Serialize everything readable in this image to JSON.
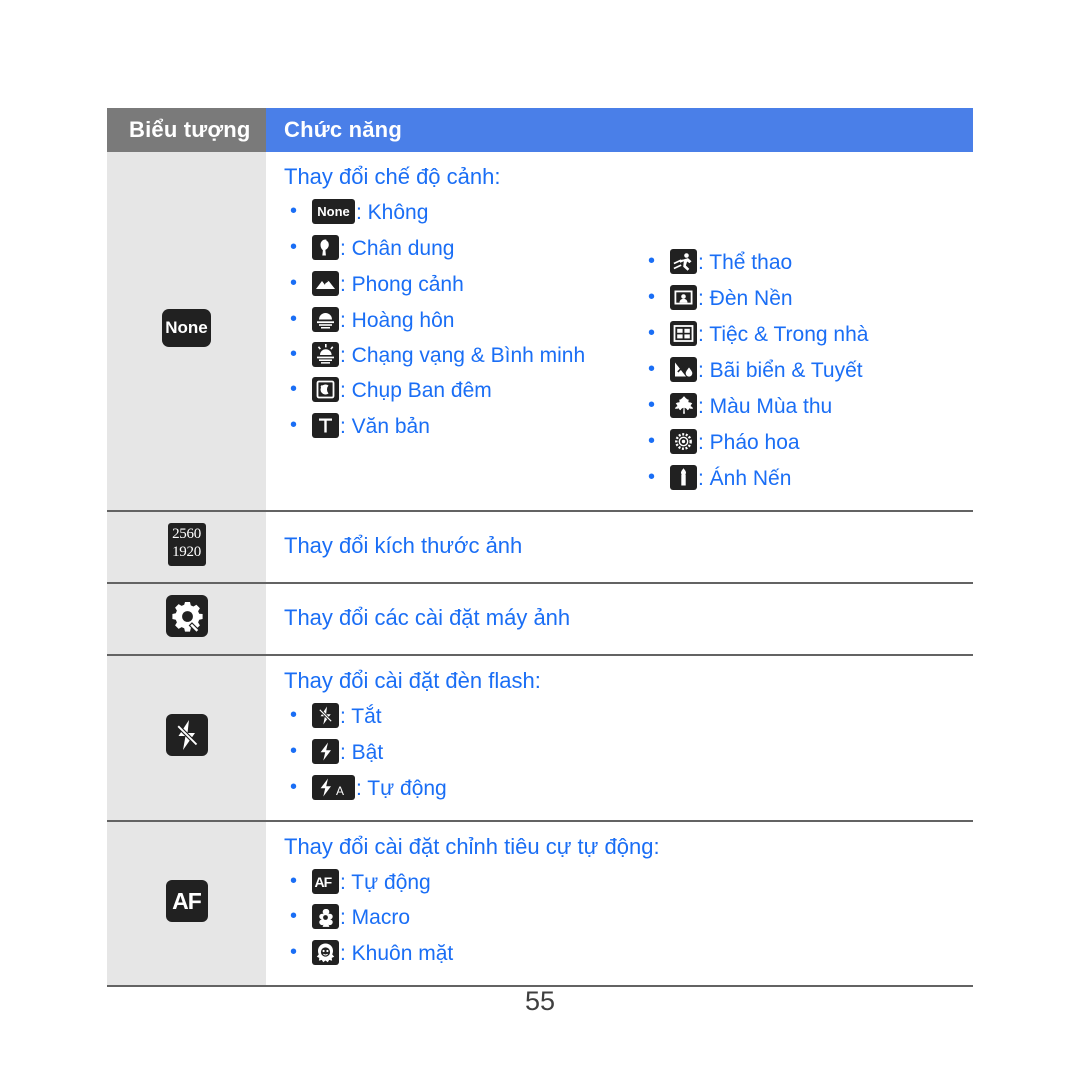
{
  "table": {
    "headers": {
      "icon_column": "Biểu tượng",
      "function_column": "Chức năng"
    },
    "rows": [
      {
        "id": "scene-mode",
        "icon_label": "None",
        "icon_name": "scene-none-icon",
        "title": "Thay đổi chế độ cảnh:",
        "options_left": [
          {
            "icon": "none-chip",
            "label": ": Không"
          },
          {
            "icon": "portrait",
            "label": ": Chân dung"
          },
          {
            "icon": "landscape",
            "label": ": Phong cảnh"
          },
          {
            "icon": "sunset",
            "label": ": Hoàng hôn"
          },
          {
            "icon": "dawn",
            "label": ": Chạng vạng & Bình minh"
          },
          {
            "icon": "night",
            "label": ": Chụp Ban đêm"
          },
          {
            "icon": "text",
            "label": ": Văn bản"
          }
        ],
        "options_right": [
          {
            "icon": "sports",
            "label": ": Thể thao"
          },
          {
            "icon": "backlight",
            "label": ": Đèn Nền"
          },
          {
            "icon": "party",
            "label": ": Tiệc & Trong nhà"
          },
          {
            "icon": "beach",
            "label": ": Bãi biển & Tuyết"
          },
          {
            "icon": "autumn",
            "label": ": Màu Mùa thu"
          },
          {
            "icon": "firework",
            "label": ": Pháo hoa"
          },
          {
            "icon": "candle",
            "label": ": Ánh Nến"
          }
        ]
      },
      {
        "id": "photo-size",
        "icon_top": "2560",
        "icon_bottom": "1920",
        "icon_name": "resolution-icon",
        "title": "Thay đổi kích thước ảnh",
        "options_left": [],
        "options_right": []
      },
      {
        "id": "camera-settings",
        "icon_name": "gear-icon",
        "title": "Thay đổi các cài đặt máy ảnh",
        "options_left": [],
        "options_right": []
      },
      {
        "id": "flash-settings",
        "icon_name": "flash-off-icon",
        "title": "Thay đổi cài đặt đèn flash:",
        "options_left": [
          {
            "icon": "flash-off",
            "label": ": Tắt"
          },
          {
            "icon": "flash-on",
            "label": ": Bật"
          },
          {
            "icon": "flash-auto",
            "label": ": Tự động"
          }
        ],
        "options_right": []
      },
      {
        "id": "autofocus-settings",
        "icon_label": "AF",
        "icon_name": "autofocus-icon",
        "title": "Thay đổi cài đặt chỉnh tiêu cự tự động:",
        "options_left": [
          {
            "icon": "af",
            "label": ": Tự động"
          },
          {
            "icon": "macro",
            "label": ": Macro"
          },
          {
            "icon": "face",
            "label": ": Khuôn mặt"
          }
        ],
        "options_right": []
      }
    ]
  },
  "footer": {
    "page_number": "55"
  },
  "colors": {
    "header_gray": "#7a7a7a",
    "header_blue": "#4a7fe8",
    "text_blue": "#1a6ef5",
    "icon_cell_bg": "#e6e6e6",
    "icon_glyph_bg": "#212121",
    "page_number": "#3f3f3f"
  }
}
